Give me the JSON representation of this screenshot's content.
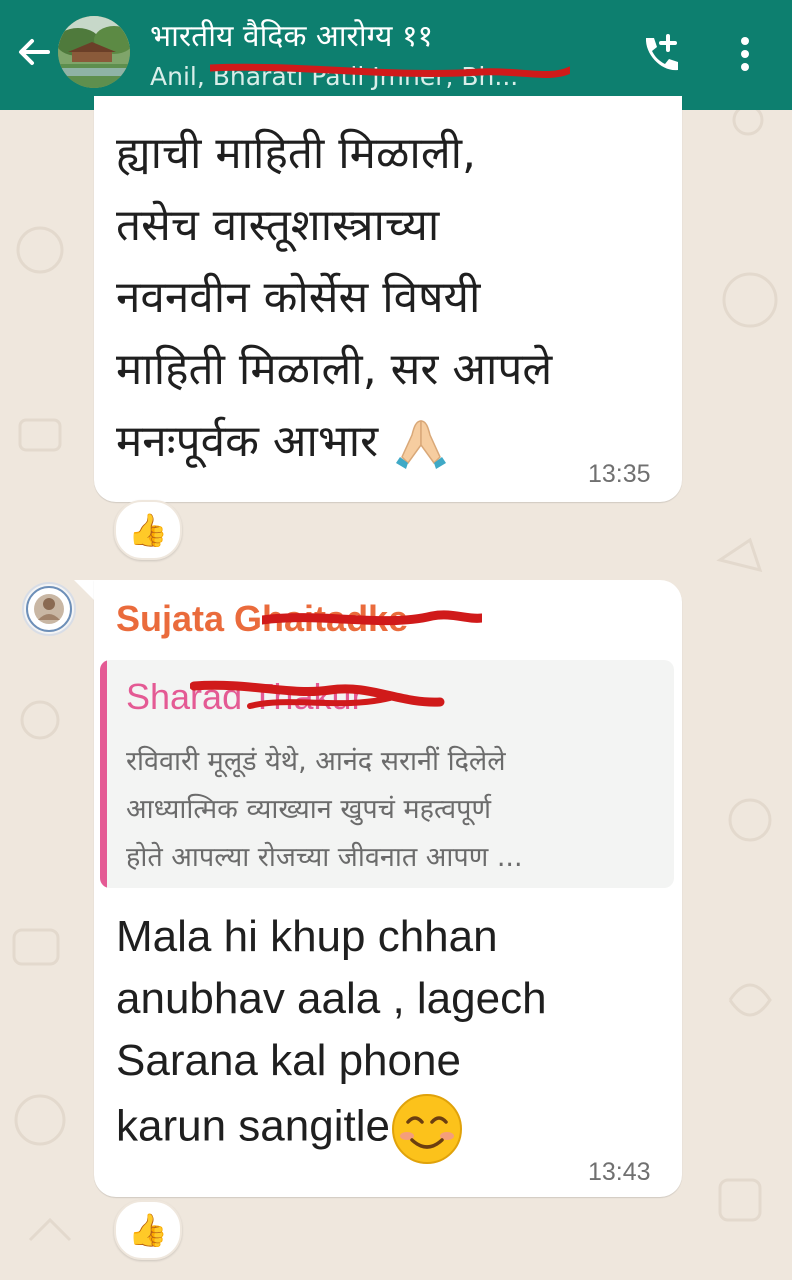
{
  "header": {
    "title": "भारतीय वैदिक आरोग्य ११",
    "subtitle": "Anil, Bharati Patil Jmner, Bh...",
    "colors": {
      "header_bg": "#0d7f6f",
      "redaction": "#d01a1a"
    }
  },
  "icons": {
    "back": "arrow-left-icon",
    "call": "add-call-icon",
    "menu": "more-vertical-icon",
    "reaction": "thumbs-up-emoji",
    "pray": "folded-hands-emoji",
    "smile": "smiling-face-emoji"
  },
  "messages": [
    {
      "lines": [
        "ह्याची माहिती मिळाली,",
        "तसेच वास्तूशास्त्राच्या",
        "नवनवीन कोर्सेस विषयी",
        "माहिती मिळाली, सर आपले",
        "मनःपूर्वक आभार"
      ],
      "time": "13:35",
      "reaction": "👍"
    },
    {
      "sender": "Sujata Ghaitadke",
      "quote": {
        "author": "Sharad Thakur",
        "lines": [
          "रविवारी मूलूडं येथे, आनंद सरानीं दिलेले",
          "आध्यात्मिक व्याख्यान खुपचं महत्वपूर्ण",
          "होते आपल्या रोजच्या जीवनात आपण ..."
        ]
      },
      "lines": [
        "Mala hi khup chhan",
        "anubhav aala , lagech",
        "Sarana kal phone",
        "karun sangitle"
      ],
      "time": "13:43",
      "reaction": "👍"
    }
  ]
}
